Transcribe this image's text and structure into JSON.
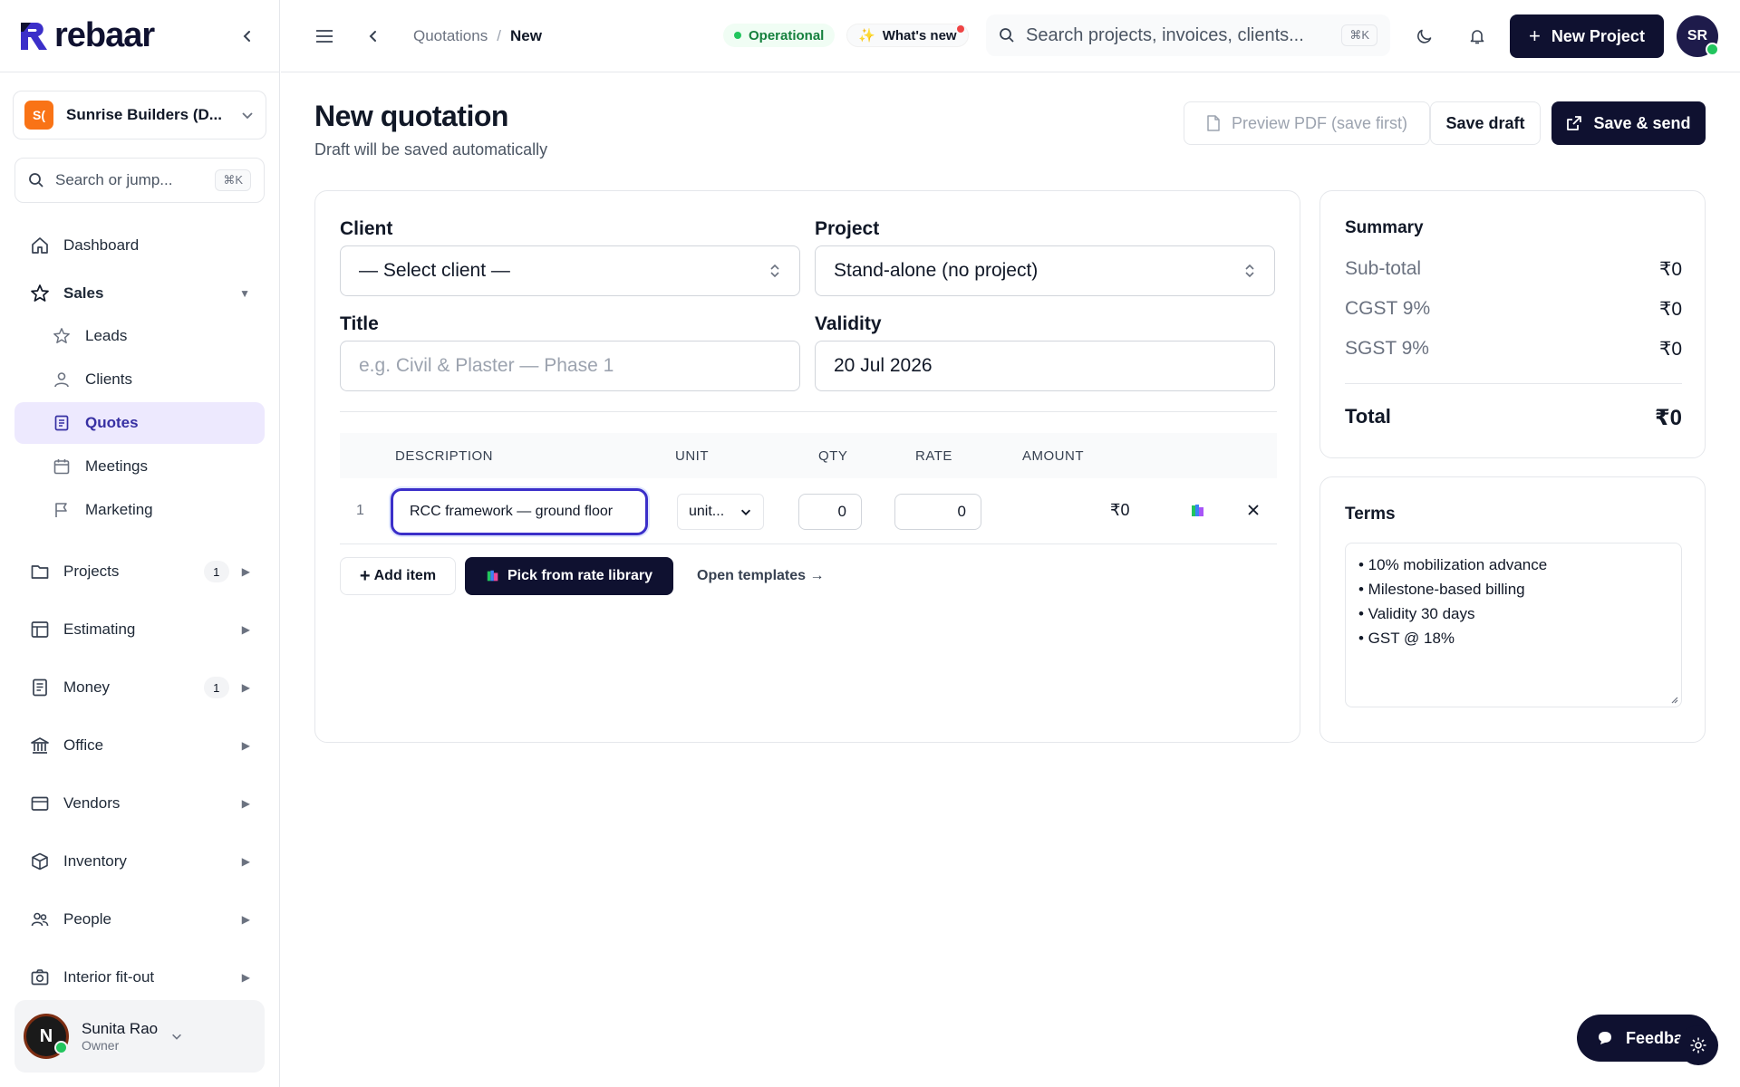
{
  "brand": {
    "name": "rebaar"
  },
  "org": {
    "badge": "S(",
    "name": "Sunrise Builders (D..."
  },
  "sidebar_search": {
    "placeholder": "Search or jump...",
    "shortcut": "⌘K"
  },
  "nav": {
    "dashboard": "Dashboard",
    "sales": "Sales",
    "sales_sub": [
      "Leads",
      "Clients",
      "Quotes",
      "Meetings",
      "Marketing"
    ],
    "projects": {
      "label": "Projects",
      "count": "1"
    },
    "estimating": "Estimating",
    "money": {
      "label": "Money",
      "count": "1"
    },
    "office": "Office",
    "vendors": "Vendors",
    "inventory": "Inventory",
    "people": "People",
    "interior": "Interior fit-out"
  },
  "user": {
    "initial": "N",
    "name": "Sunita Rao",
    "role": "Owner"
  },
  "topbar": {
    "breadcrumb": [
      "Quotations",
      "New"
    ],
    "status": "Operational",
    "whats_new": "What's new",
    "search_placeholder": "Search projects, invoices, clients...",
    "search_shortcut": "⌘K",
    "new_project": "New Project",
    "avatar": "SR"
  },
  "page": {
    "title": "New quotation",
    "subtitle": "Draft will be saved automatically",
    "preview_btn": "Preview PDF (save first)",
    "save_draft_btn": "Save draft",
    "save_send_btn": "Save & send"
  },
  "form": {
    "client_label": "Client",
    "client_value": "— Select client —",
    "project_label": "Project",
    "project_value": "Stand-alone (no project)",
    "title_label": "Title",
    "title_placeholder": "e.g. Civil & Plaster — Phase 1",
    "validity_label": "Validity",
    "validity_value": "20 Jul 2026"
  },
  "table": {
    "headers": [
      "DESCRIPTION",
      "UNIT",
      "QTY",
      "RATE",
      "AMOUNT"
    ],
    "rows": [
      {
        "index": "1",
        "description": "RCC framework — ground floor",
        "unit": "unit...",
        "qty": "0",
        "rate": "0",
        "amount": "₹0"
      }
    ],
    "add_item": "Add item",
    "pick_library": "Pick from rate library",
    "open_templates": "Open templates →"
  },
  "summary": {
    "title": "Summary",
    "rows": [
      {
        "label": "Sub-total",
        "value": "₹0"
      },
      {
        "label": "CGST 9%",
        "value": "₹0"
      },
      {
        "label": "SGST 9%",
        "value": "₹0"
      }
    ],
    "total_label": "Total",
    "total_value": "₹0"
  },
  "terms": {
    "title": "Terms",
    "lines": [
      "• 10% mobilization advance",
      "• Milestone-based billing",
      "• Validity 30 days",
      "• GST @ 18%"
    ]
  },
  "feedback": {
    "label": "Feedba"
  },
  "colors": {
    "brand": "#0f1130",
    "accent": "#3b2fc9",
    "success": "#22c55e",
    "org_badge": "#f97316"
  }
}
